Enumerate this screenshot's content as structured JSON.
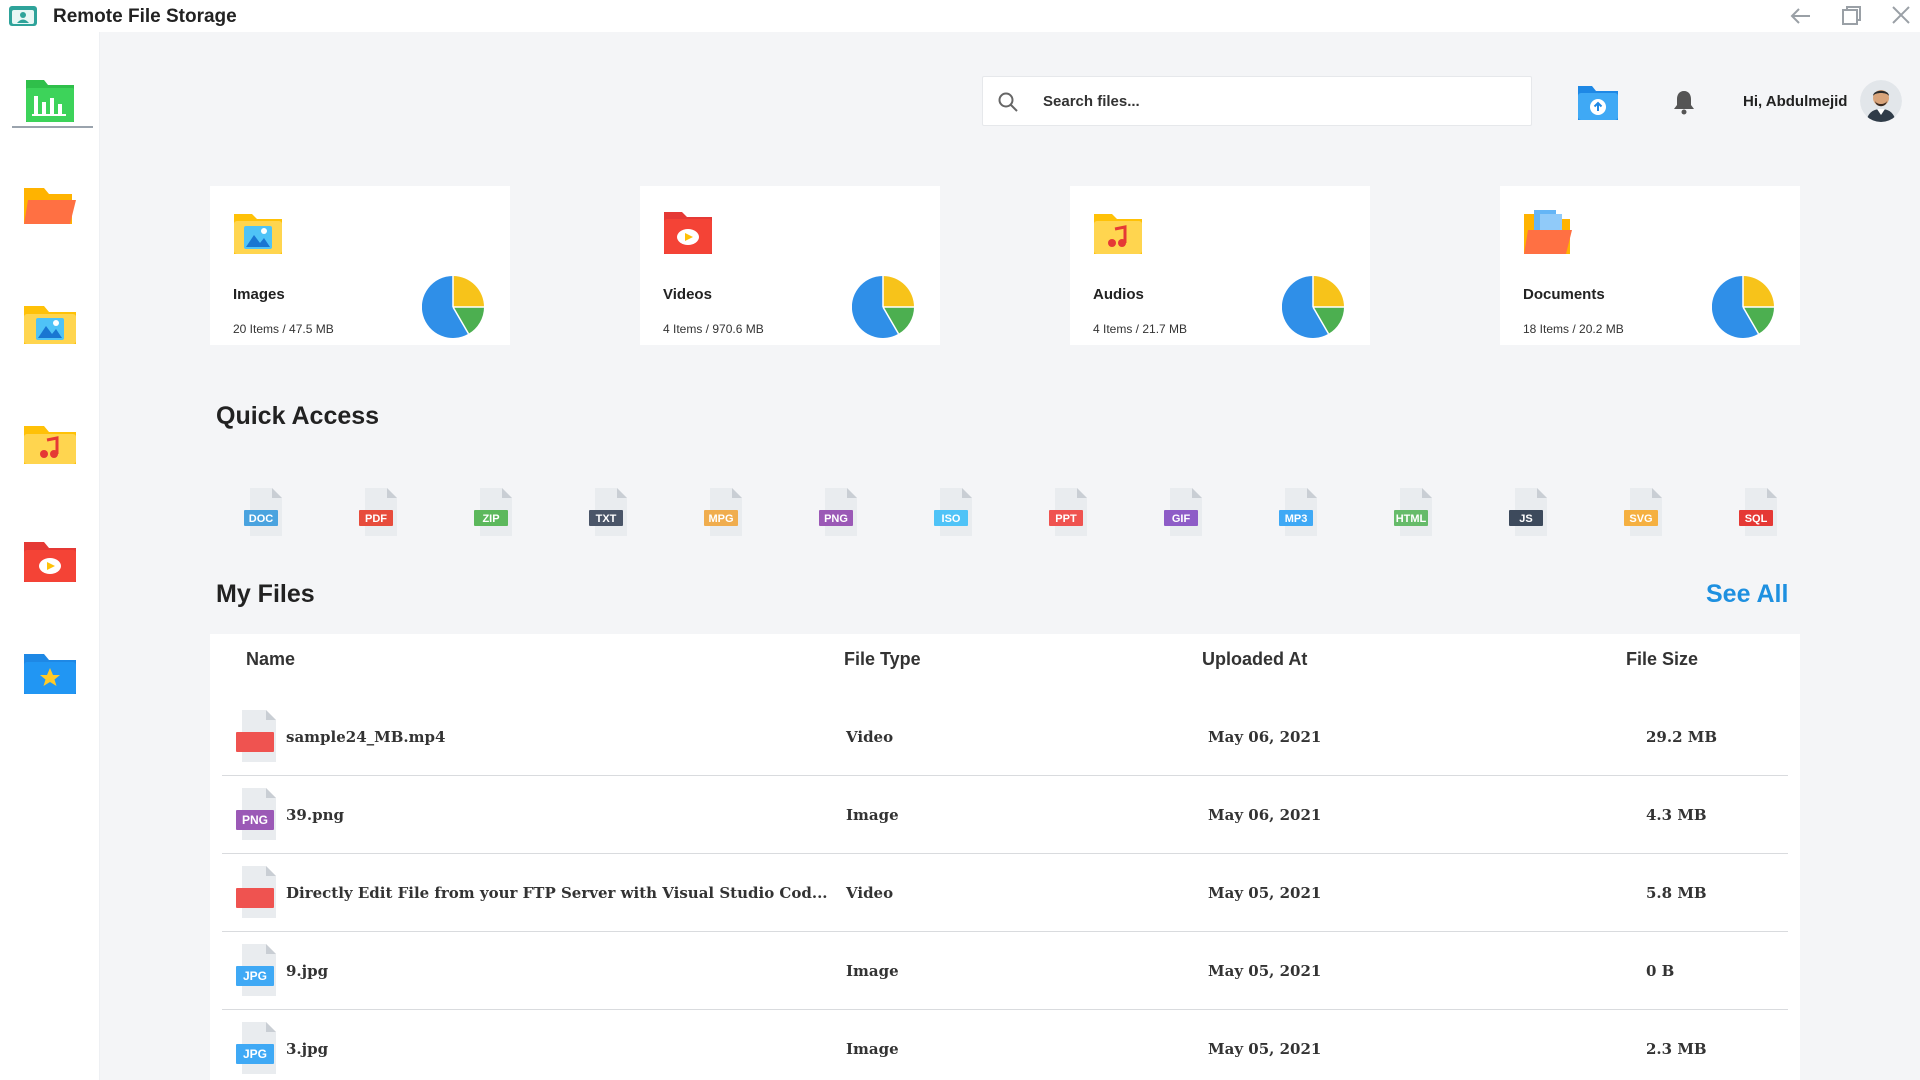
{
  "app": {
    "title": "Remote File Storage"
  },
  "header": {
    "search_placeholder": "Search files...",
    "greeting": "Hi, Abdulmejid"
  },
  "categories": [
    {
      "name": "Images",
      "meta": "20 Items / 47.5 MB",
      "icon": "image-folder-icon"
    },
    {
      "name": "Videos",
      "meta": "4 Items / 970.6 MB",
      "icon": "video-folder-icon"
    },
    {
      "name": "Audios",
      "meta": "4 Items / 21.7 MB",
      "icon": "audio-folder-icon"
    },
    {
      "name": "Documents",
      "meta": "18 Items / 20.2 MB",
      "icon": "document-folder-icon"
    }
  ],
  "quick_access": {
    "title": "Quick Access",
    "types": [
      {
        "label": "DOC",
        "color": "#4aa3df"
      },
      {
        "label": "PDF",
        "color": "#e74c3c"
      },
      {
        "label": "ZIP",
        "color": "#5cb85c"
      },
      {
        "label": "TXT",
        "color": "#4a5568"
      },
      {
        "label": "MPG",
        "color": "#f0ad4e"
      },
      {
        "label": "PNG",
        "color": "#9b59b6"
      },
      {
        "label": "ISO",
        "color": "#4fc3f7"
      },
      {
        "label": "PPT",
        "color": "#ef5350"
      },
      {
        "label": "GIF",
        "color": "#8e5cc7"
      },
      {
        "label": "MP3",
        "color": "#3fa9f5"
      },
      {
        "label": "HTML",
        "color": "#66bb6a"
      },
      {
        "label": "JS",
        "color": "#3d4a5c"
      },
      {
        "label": "SVG",
        "color": "#f5b041"
      },
      {
        "label": "SQL",
        "color": "#e53935"
      }
    ]
  },
  "my_files": {
    "title": "My Files",
    "see_all": "See All",
    "columns": {
      "name": "Name",
      "type": "File Type",
      "uploaded": "Uploaded At",
      "size": "File Size"
    },
    "rows": [
      {
        "name": "sample24_MB.mp4",
        "type": "Video",
        "uploaded": "May 06, 2021",
        "size": "29.2 MB",
        "badge": "",
        "badge_color": "#ef5350"
      },
      {
        "name": "39.png",
        "type": "Image",
        "uploaded": "May 06, 2021",
        "size": "4.3 MB",
        "badge": "PNG",
        "badge_color": "#9b59b6"
      },
      {
        "name": "Directly Edit File from your FTP Server with Visual Studio Cod...",
        "type": "Video",
        "uploaded": "May 05, 2021",
        "size": "5.8 MB",
        "badge": "",
        "badge_color": "#ef5350"
      },
      {
        "name": "9.jpg",
        "type": "Image",
        "uploaded": "May 05, 2021",
        "size": "0 B",
        "badge": "JPG",
        "badge_color": "#3fa9f5"
      },
      {
        "name": "3.jpg",
        "type": "Image",
        "uploaded": "May 05, 2021",
        "size": "2.3 MB",
        "badge": "JPG",
        "badge_color": "#3fa9f5"
      }
    ]
  },
  "colors": {
    "accent": "#1e90e0",
    "pie_blue": "#2f8fe8",
    "pie_yellow": "#f7c31a",
    "pie_green": "#4caf50"
  }
}
